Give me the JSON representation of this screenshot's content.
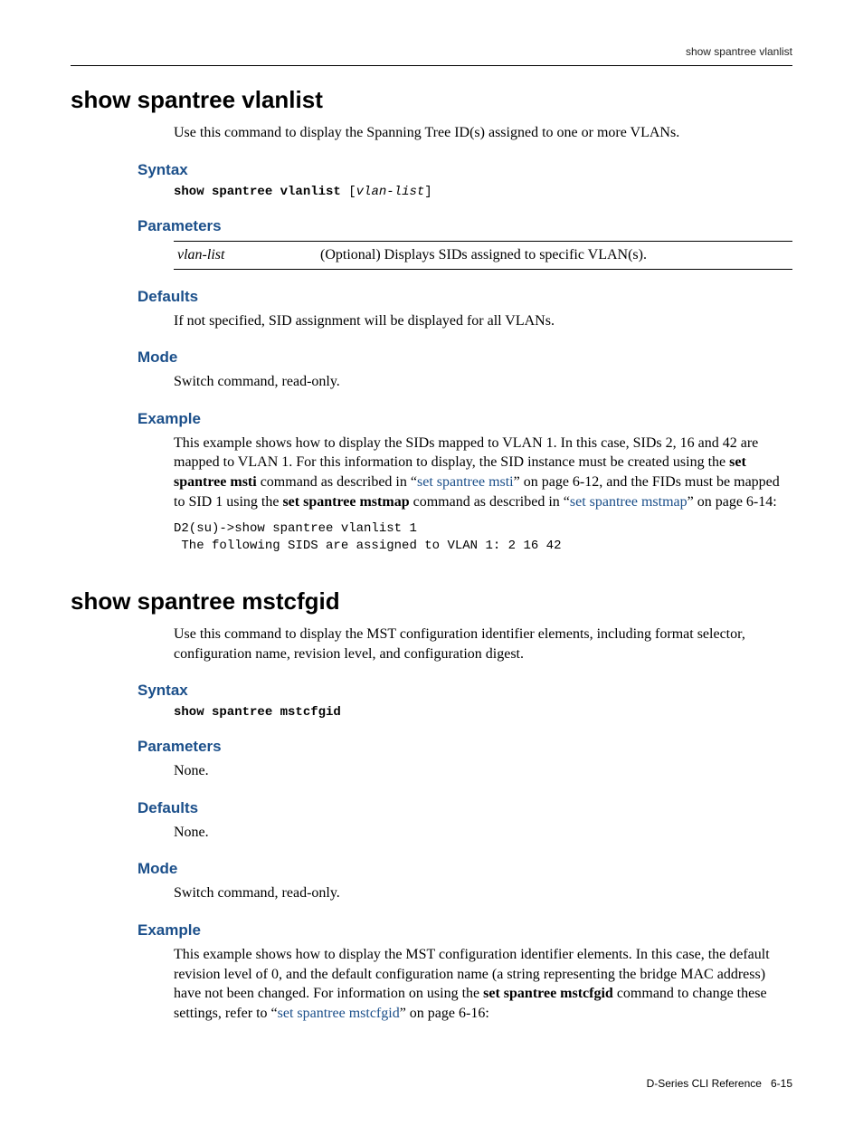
{
  "header": {
    "running": "show spantree vlanlist"
  },
  "cmd1": {
    "title": "show spantree vlanlist",
    "intro": "Use this command to display the Spanning Tree ID(s) assigned to one or more VLANs.",
    "syntax_heading": "Syntax",
    "syntax_kw": "show spantree vlanlist",
    "syntax_arg": "vlan-list",
    "params_heading": "Parameters",
    "param_name": "vlan-list",
    "param_desc": "(Optional) Displays SIDs assigned to specific VLAN(s).",
    "defaults_heading": "Defaults",
    "defaults_body": "If not specified, SID assignment will be displayed for all VLANs.",
    "mode_heading": "Mode",
    "mode_body": "Switch command, read-only.",
    "example_heading": "Example",
    "example_pre1": "This example shows how to display the SIDs mapped to VLAN 1. In this case, SIDs 2, 16 and 42 are mapped to VLAN 1. For this information to display, the SID instance must be created using the ",
    "example_bold1": "set spantree msti",
    "example_mid1": " command as described in “",
    "example_link1": "set spantree msti",
    "example_after_link1": "” on page 6-12, and the FIDs must be mapped to SID 1 using the ",
    "example_bold2": "set spantree mstmap",
    "example_mid2": " command as described in “",
    "example_link2": "set spantree mstmap",
    "example_after_link2": "” on page 6-14:",
    "code": "D2(su)->show spantree vlanlist 1\n The following SIDS are assigned to VLAN 1: 2 16 42"
  },
  "cmd2": {
    "title": "show spantree mstcfgid",
    "intro": "Use this command to display the MST configuration identifier elements, including format selector, configuration name, revision level, and configuration digest.",
    "syntax_heading": "Syntax",
    "syntax_kw": "show spantree mstcfgid",
    "params_heading": "Parameters",
    "params_body": "None.",
    "defaults_heading": "Defaults",
    "defaults_body": "None.",
    "mode_heading": "Mode",
    "mode_body": "Switch command, read-only.",
    "example_heading": "Example",
    "example_pre1": "This example shows how to display the MST configuration identifier elements. In this case, the default revision level of 0, and the default configuration name (a string representing the bridge MAC address) have not been changed. For information on using the ",
    "example_bold1": "set spantree mstcfgid",
    "example_mid1": " command to change these settings, refer to “",
    "example_link1": "set spantree mstcfgid",
    "example_after_link1": "” on page 6-16:"
  },
  "footer": {
    "left": "D-Series CLI Reference",
    "right": "6-15"
  }
}
